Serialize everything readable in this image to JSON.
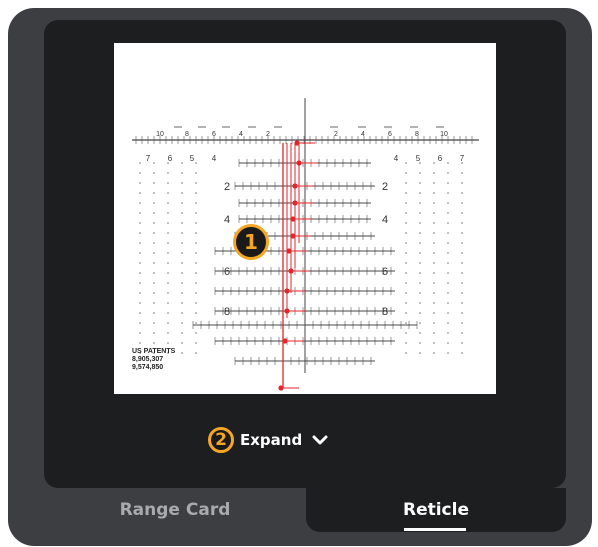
{
  "reticle": {
    "callout_1": "1",
    "patent_lines": [
      "US PATENTS",
      "8,905,307",
      "9,574,850"
    ],
    "left_numbers": [
      "7",
      "6",
      "5",
      "4"
    ],
    "right_numbers": [
      "4",
      "5",
      "6",
      "7"
    ],
    "top_left_numbers": [
      "10",
      "8",
      "6",
      "4",
      "2"
    ],
    "top_right_numbers": [
      "2",
      "4",
      "6",
      "8",
      "10"
    ],
    "side_labels": [
      "2",
      "4",
      "6",
      "8"
    ],
    "accent_color": "#e4262a"
  },
  "expand": {
    "badge": "2",
    "label": "Expand",
    "icon": "chevron-down-icon"
  },
  "tabs": [
    {
      "label": "Range Card",
      "active": false
    },
    {
      "label": "Reticle",
      "active": true
    }
  ],
  "colors": {
    "badge_ring": "#f5a623",
    "panel": "#1d1e20",
    "device": "#3d3e41"
  }
}
